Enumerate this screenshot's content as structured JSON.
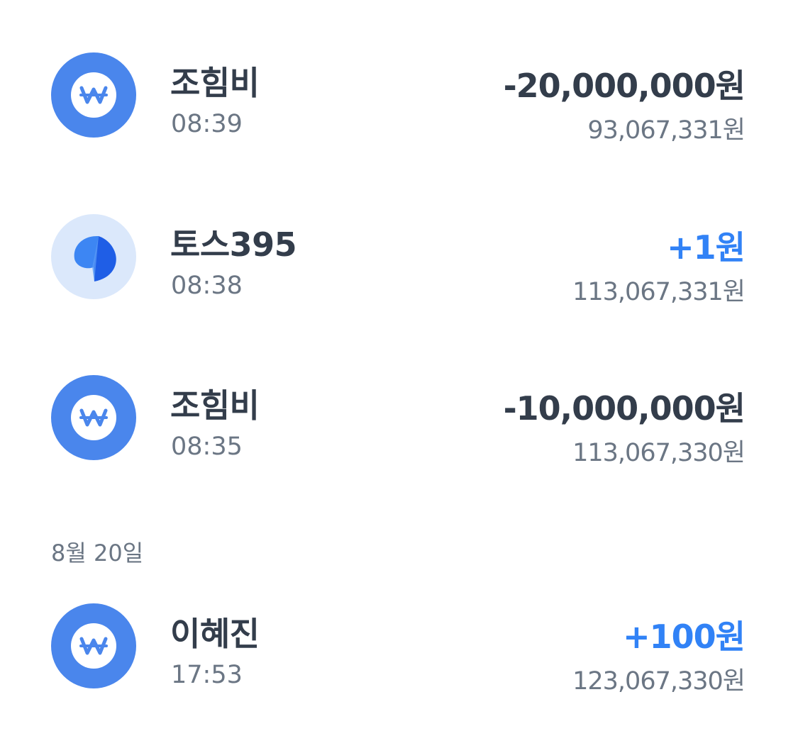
{
  "transactions": [
    {
      "name": "조힘비",
      "time": "08:39",
      "amount": "-20,000,000원",
      "balance": "93,067,331원",
      "icon": "won-icon",
      "direction": "out"
    },
    {
      "name": "토스395",
      "time": "08:38",
      "amount": "+1원",
      "balance": "113,067,331원",
      "icon": "toss-logo-icon",
      "direction": "in"
    },
    {
      "name": "조힘비",
      "time": "08:35",
      "amount": "-10,000,000원",
      "balance": "113,067,330원",
      "icon": "won-icon",
      "direction": "out"
    }
  ],
  "date_header": "8월 20일",
  "transactions_aug20": [
    {
      "name": "이혜진",
      "time": "17:53",
      "amount": "+100원",
      "balance": "123,067,330원",
      "icon": "won-icon",
      "direction": "in"
    }
  ],
  "colors": {
    "text_primary": "#333d4b",
    "text_secondary": "#6b7684",
    "deposit_blue": "#3182f6",
    "won_icon_blue": "#4a86ec",
    "toss_icon_bg": "#dbe8fb"
  }
}
